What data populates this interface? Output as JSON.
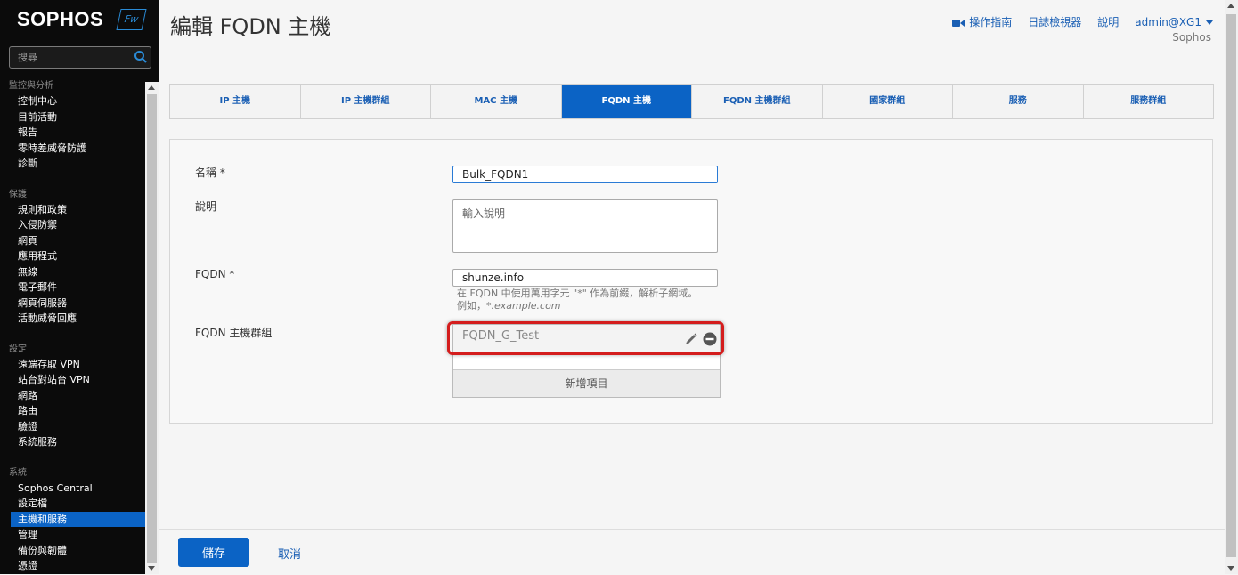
{
  "brand": {
    "name": "SOPHOS",
    "badge": "Fw"
  },
  "sidebar": {
    "search_placeholder": "搜尋",
    "sections": [
      {
        "title": "監控與分析",
        "items": [
          "控制中心",
          "目前活動",
          "報告",
          "零時差威脅防護",
          "診斷"
        ]
      },
      {
        "title": "保護",
        "items": [
          "規則和政策",
          "入侵防禦",
          "網頁",
          "應用程式",
          "無線",
          "電子郵件",
          "網頁伺服器",
          "活動威脅回應"
        ]
      },
      {
        "title": "設定",
        "items": [
          "遠端存取 VPN",
          "站台對站台 VPN",
          "網路",
          "路由",
          "驗證",
          "系統服務"
        ]
      },
      {
        "title": "系統",
        "items": [
          "Sophos Central",
          "設定檔",
          "主機和服務",
          "管理",
          "備份與韌體",
          "憑證"
        ]
      }
    ],
    "active_item": "主機和服務"
  },
  "header": {
    "title": "編輯 FQDN 主機",
    "links": {
      "guide": "操作指南",
      "log_viewer": "日誌檢視器",
      "help": "說明",
      "user": "admin@XG1"
    },
    "org": "Sophos"
  },
  "tabs": [
    "IP 主機",
    "IP 主機群組",
    "MAC 主機",
    "FQDN 主機",
    "FQDN 主機群組",
    "國家群組",
    "服務",
    "服務群組"
  ],
  "active_tab": "FQDN 主機",
  "form": {
    "name_label": "名稱 *",
    "name_value": "Bulk_FQDN1",
    "desc_label": "說明",
    "desc_placeholder": "輸入說明",
    "fqdn_label": "FQDN *",
    "fqdn_value": "shunze.info",
    "fqdn_hint_line1": "在 FQDN 中使用萬用字元 \"*\" 作為前綴，解析子網域。",
    "fqdn_hint_prefix": "例如，",
    "fqdn_hint_example": "*.example.com",
    "group_label": "FQDN 主機群組",
    "group_items": [
      "FQDN_G_Test"
    ],
    "add_item_label": "新增項目"
  },
  "footer": {
    "save_label": "儲存",
    "cancel_label": "取消"
  },
  "colors": {
    "accent": "#0b63c5",
    "highlight": "#d41d1d",
    "sidebar_bg": "#0b0b0b"
  }
}
